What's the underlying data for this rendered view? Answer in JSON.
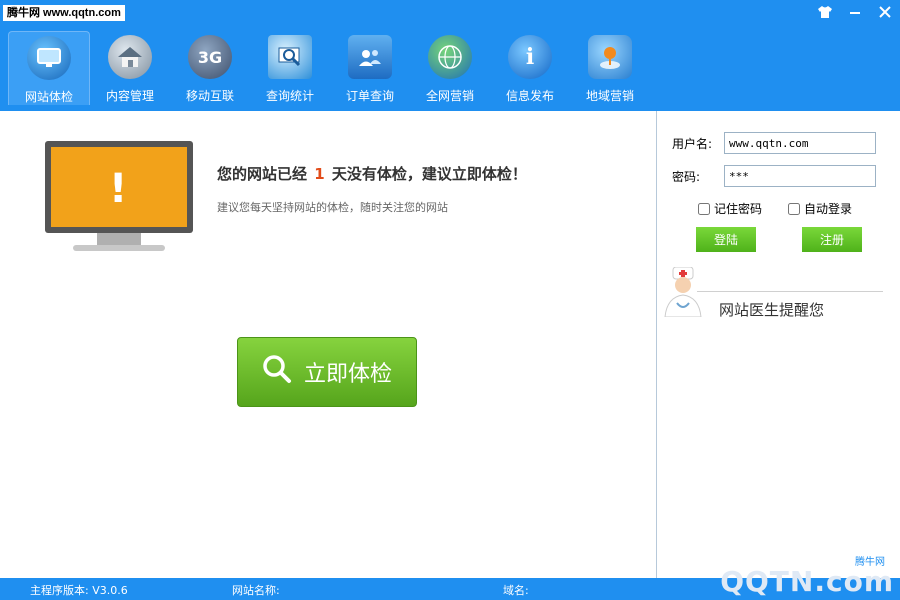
{
  "logo_text": "腾牛网 www.qqtn.com",
  "nav": {
    "items": [
      {
        "label": "网站体检",
        "icon": "monitor-icon"
      },
      {
        "label": "内容管理",
        "icon": "house-icon"
      },
      {
        "label": "移动互联",
        "icon": "3g-icon",
        "glyph": "3G"
      },
      {
        "label": "查询统计",
        "icon": "magnifier-monitor-icon"
      },
      {
        "label": "订单查询",
        "icon": "users-icon"
      },
      {
        "label": "全网营销",
        "icon": "globe-icon"
      },
      {
        "label": "信息发布",
        "icon": "info-icon",
        "glyph": "i"
      },
      {
        "label": "地域营销",
        "icon": "map-pin-icon"
      }
    ]
  },
  "main": {
    "msg_prefix": "您的网站已经",
    "days": "1",
    "msg_suffix": "天没有体检，建议立即体检！",
    "msg_sub": "建议您每天坚持网站的体检，随时关注您的网站",
    "check_button": "立即体检"
  },
  "login": {
    "username_label": "用户名:",
    "username_value": "www.qqtn.com",
    "password_label": "密码:",
    "password_value": "***",
    "remember_label": "记住密码",
    "autologin_label": "自动登录",
    "login_button": "登陆",
    "register_button": "注册"
  },
  "doctor": {
    "text": "网站医生提醒您"
  },
  "status": {
    "version": "主程序版本: V3.0.6",
    "site_name": "网站名称:",
    "domain": "域名:"
  },
  "watermark": {
    "text": "QQTN.com",
    "badge": "腾牛网"
  },
  "colors": {
    "topbar": "#1f8ff0",
    "accent_orange": "#f2a21a",
    "button_green": "#56a51c"
  }
}
